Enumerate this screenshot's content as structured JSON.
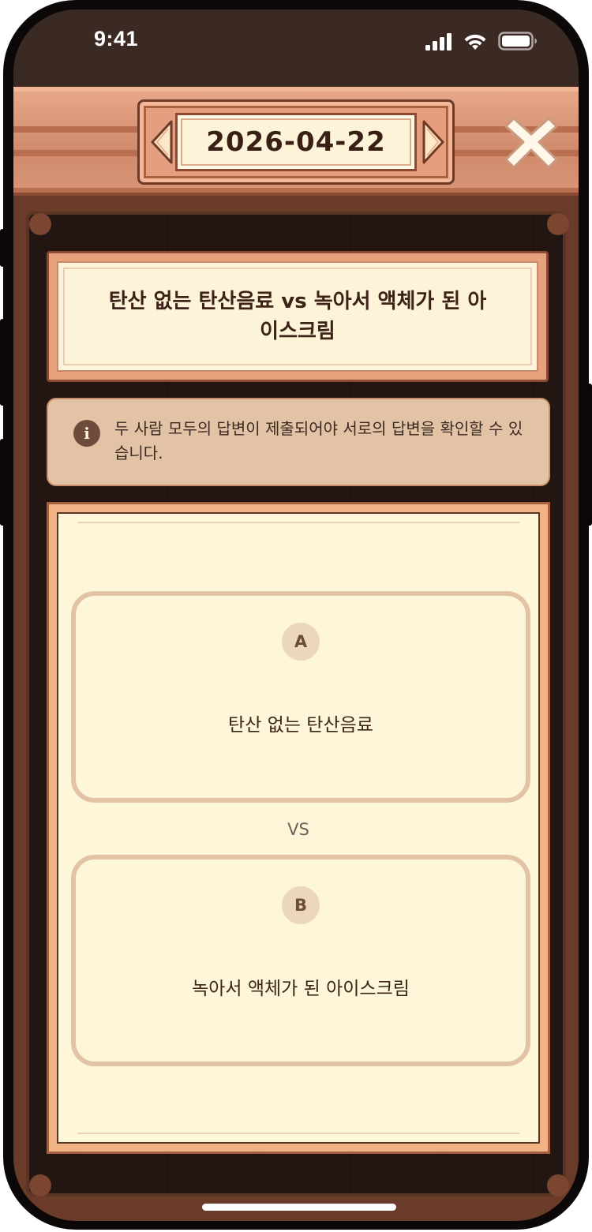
{
  "status_bar": {
    "time": "9:41"
  },
  "header": {
    "date": "2026-04-22",
    "prev_icon": "chevron-left-icon",
    "next_icon": "chevron-right-icon",
    "close_icon": "close-icon"
  },
  "question": {
    "title": "탄산 없는 탄산음료 vs 녹아서 액체가 된 아이스크림"
  },
  "notice": {
    "icon": "info-icon",
    "text": "두 사람 모두의 답변이 제출되어야 서로의 답변을 확인할 수 있습니다."
  },
  "choices": {
    "a": {
      "badge": "A",
      "text": "탄산 없는 탄산음료"
    },
    "vs": "VS",
    "b": {
      "badge": "B",
      "text": "녹아서 액체가 된 아이스크림"
    }
  },
  "colors": {
    "wood_dark": "#231612",
    "wood_frame": "#6b3b29",
    "parchment": "#fdf6d9",
    "header_wood": "#d99577",
    "text_brown": "#3d2317"
  }
}
